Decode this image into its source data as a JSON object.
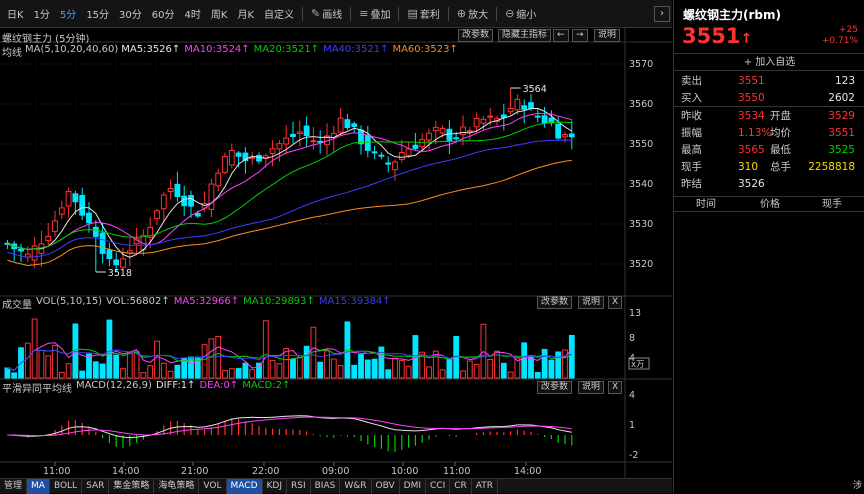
{
  "toolbar": {
    "periods": [
      "日K",
      "1分",
      "5分",
      "15分",
      "30分",
      "60分",
      "4时",
      "周K",
      "月K",
      "自定义"
    ],
    "active_period_index": 2,
    "tools": [
      {
        "icon": "pen-icon",
        "glyph": "✎",
        "label": "画线"
      },
      {
        "icon": "layers-icon",
        "glyph": "≡",
        "label": "叠加"
      },
      {
        "icon": "bar-icon",
        "glyph": "▤",
        "label": "套利"
      },
      {
        "icon": "zoom-in-icon",
        "glyph": "⊕",
        "label": "放大"
      },
      {
        "icon": "zoom-out-icon",
        "glyph": "⊖",
        "label": "缩小"
      }
    ],
    "collapse_glyph": "›"
  },
  "main_chart": {
    "title": "螺纹钢主力 (5分钟)",
    "ma_prefix": "均线",
    "ma_base": "MA(5,10,20,40,60)",
    "ma_values": [
      {
        "label": "MA5:3526↑",
        "color": "#e6e6e6"
      },
      {
        "label": "MA10:3524↑",
        "color": "#ff40ff"
      },
      {
        "label": "MA20:3521↑",
        "color": "#00d000"
      },
      {
        "label": "MA40:3521↑",
        "color": "#3c3cff"
      },
      {
        "label": "MA60:3523↑",
        "color": "#ff8a1e"
      }
    ],
    "buttons": [
      "改参数",
      "隐藏主指标",
      "←",
      "→",
      "说明"
    ],
    "price_axis": [
      "3570",
      "3560",
      "3550",
      "3540",
      "3530",
      "3520"
    ],
    "high_label": "3564",
    "low_label": "3518"
  },
  "volume": {
    "title": "成交量",
    "base": "VOL(5,10,15)",
    "vol_value": "VOL:56802↑",
    "ma_values": [
      {
        "label": "MA5:32966↑",
        "color": "#ff40ff"
      },
      {
        "label": "MA10:29893↑",
        "color": "#00d000"
      },
      {
        "label": "MA15:39384↑",
        "color": "#3c3cff"
      }
    ],
    "buttons": [
      "改参数",
      "说明",
      "X"
    ],
    "axis": [
      "13",
      "8",
      "4"
    ],
    "unit": "x万"
  },
  "macd": {
    "title": "平滑异同平均线",
    "base": "MACD(12,26,9)",
    "values": [
      {
        "label": "DIFF:1↑",
        "color": "#e6e6e6"
      },
      {
        "label": "DEA:0↑",
        "color": "#ff40ff"
      },
      {
        "label": "MACD:2↑",
        "color": "#00d000"
      }
    ],
    "buttons": [
      "改参数",
      "说明",
      "X"
    ],
    "axis": [
      "4",
      "1",
      "-2"
    ]
  },
  "time_axis": [
    "11:00",
    "14:00",
    "21:00",
    "22:00",
    "09:00",
    "10:00",
    "11:00",
    "14:00"
  ],
  "bottom_tabs": [
    "管理",
    "MA",
    "BOLL",
    "SAR",
    "集金策略",
    "海龟策略",
    "VOL",
    "MACD",
    "KDJ",
    "RSI",
    "BIAS",
    "W&R",
    "OBV",
    "DMI",
    "CCI",
    "CR",
    "ATR"
  ],
  "bottom_active": [
    1,
    7
  ],
  "quote": {
    "title": "螺纹钢主力(rbm)",
    "price": "3551",
    "arrow": "↑",
    "change": "+25",
    "change_pct": "+0.71%",
    "add_favorite": "+ 加入自选",
    "sell": {
      "label": "卖出",
      "price": "3551",
      "vol": "123"
    },
    "buy": {
      "label": "买入",
      "price": "3550",
      "vol": "2602"
    },
    "rows": [
      [
        {
          "label": "昨收",
          "val": "3534",
          "c": "red"
        },
        {
          "label": "开盘",
          "val": "3529",
          "c": "red"
        }
      ],
      [
        {
          "label": "振幅",
          "val": "1.13%",
          "c": "red"
        },
        {
          "label": "均价",
          "val": "3551",
          "c": "red"
        }
      ],
      [
        {
          "label": "最高",
          "val": "3565",
          "c": "red"
        },
        {
          "label": "最低",
          "val": "3525",
          "c": "green"
        }
      ],
      [
        {
          "label": "现手",
          "val": "310",
          "c": "yel"
        },
        {
          "label": "总手",
          "val": "2258818",
          "c": "yel"
        }
      ],
      [
        {
          "label": "昨结",
          "val": "3526",
          "c": "white"
        }
      ]
    ],
    "table_headers": [
      "时间",
      "价格",
      "现手"
    ]
  },
  "footer_char": "涉"
}
